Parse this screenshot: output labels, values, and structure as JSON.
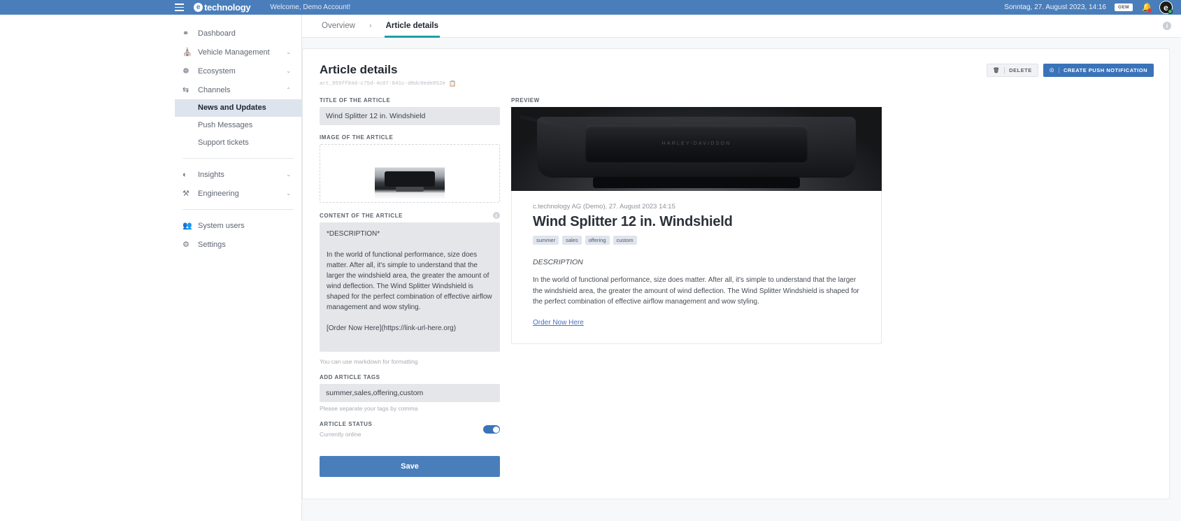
{
  "topbar": {
    "menu_icon": "hamburger-icon",
    "brand_mark": "e",
    "brand": "technology",
    "welcome": "Welcome, Demo Account!",
    "datetime": "Sonntag, 27. August 2023, 14:16",
    "badge": "OEM",
    "bell_icon": "notification-bell-icon",
    "avatar_initial": "e",
    "bg_color": "#4a7ebb"
  },
  "sidebar": {
    "items": [
      {
        "label": "Dashboard",
        "icon": "gauge-icon",
        "expandable": false
      },
      {
        "label": "Vehicle Management",
        "icon": "vehicle-icon",
        "expandable": true,
        "chevron": "⌄"
      },
      {
        "label": "Ecosystem",
        "icon": "ecosystem-icon",
        "expandable": true,
        "chevron": "⌄"
      },
      {
        "label": "Channels",
        "icon": "channels-icon",
        "expandable": true,
        "chevron": "⌃",
        "expanded": true
      },
      {
        "label": "Insights",
        "icon": "pie-chart-icon",
        "expandable": true,
        "chevron": "⌄"
      },
      {
        "label": "Engineering",
        "icon": "tools-icon",
        "expandable": true,
        "chevron": "⌄"
      },
      {
        "label": "System users",
        "icon": "users-icon",
        "expandable": false
      },
      {
        "label": "Settings",
        "icon": "gear-icon",
        "expandable": false
      }
    ],
    "channels_children": [
      {
        "label": "News and Updates",
        "active": true
      },
      {
        "label": "Push Messages",
        "active": false
      },
      {
        "label": "Support tickets",
        "active": false
      }
    ]
  },
  "tabs": {
    "overview": "Overview",
    "separator": "›",
    "article_details": "Article details",
    "help_icon": "info-icon",
    "active_underline_color": "#1c9fa8"
  },
  "page": {
    "title": "Article details",
    "article_id": "art_959ff84d-c75d-4c07-841c-d8dc8ede852e",
    "copy_icon": "copy-icon",
    "delete_label": "DELETE",
    "delete_icon": "trash-icon",
    "push_label": "CREATE PUSH NOTIFICATION",
    "push_icon": "bell-plus-icon"
  },
  "form": {
    "title_label": "TITLE OF THE ARTICLE",
    "title_value": "Wind Splitter 12 in. Windshield",
    "image_label": "IMAGE OF THE ARTICLE",
    "content_label": "CONTENT OF THE ARTICLE",
    "content_info_icon": "info-icon",
    "content_value": "*DESCRIPTION*\n\nIn the world of functional performance, size does matter. After all, it's simple to understand that the larger the windshield area, the greater the amount of wind deflection. The Wind Splitter Windshield is shaped for the perfect combination of effective airflow management and wow styling.\n\n[Order Now Here](https://link-url-here.org)",
    "content_hint": "You can use markdown for formatting",
    "tags_label": "ADD ARTICLE TAGS",
    "tags_value": "summer,sales,offering,custom",
    "tags_hint": "Please separate your tags by comma",
    "status_label": "ARTICLE STATUS",
    "status_value": "Currently online",
    "status_on": true,
    "save_label": "Save",
    "save_color": "#4a7ebb"
  },
  "preview": {
    "label": "PREVIEW",
    "hero_wordmark": "HARLEY-DAVIDSON",
    "meta": "c.technology AG (Demo), 27. August 2023 14:15",
    "title": "Wind Splitter 12 in. Windshield",
    "tags": [
      "summer",
      "sales",
      "offering",
      "custom"
    ],
    "description_heading": "DESCRIPTION",
    "description_body": "In the world of functional performance, size does matter. After all, it's simple to understand that the larger the windshield area, the greater the amount of wind deflection. The Wind Splitter Windshield is shaped for the perfect combination of effective airflow management and wow styling.",
    "link_text": "Order Now Here"
  }
}
